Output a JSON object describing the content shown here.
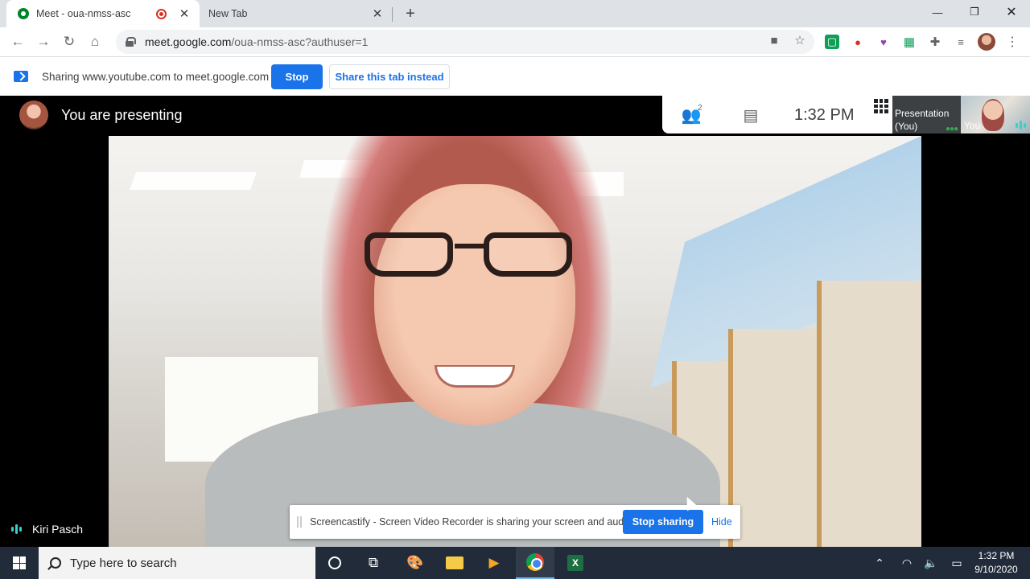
{
  "browser": {
    "tabs": [
      {
        "title": "Meet - oua-nmss-asc",
        "active": true,
        "recording": true
      },
      {
        "title": "New Tab",
        "active": false
      }
    ],
    "url_host": "meet.google.com",
    "url_path": "/oua-nmss-asc?authuser=1"
  },
  "infobar": {
    "message": "Sharing www.youtube.com to meet.google.com",
    "stop_label": "Stop",
    "share_tab_label": "Share this tab instead"
  },
  "meet": {
    "presenting_text": "You are presenting",
    "participants_badge": "2",
    "time": "1:32  PM",
    "presentation_tile_label": "Presentation (You)",
    "self_tile_label": "You",
    "speaker_name": "Kiri Pasch"
  },
  "screencastify": {
    "message": "Screencastify - Screen Video Recorder is sharing your screen and audio.",
    "stop_sharing_label": "Stop sharing",
    "hide_label": "Hide"
  },
  "taskbar": {
    "search_placeholder": "Type here to search",
    "clock_time": "1:32 PM",
    "clock_date": "9/10/2020"
  },
  "colors": {
    "accent": "#1a73e8",
    "taskbar": "#212b3a",
    "tabstrip": "#dee1e6",
    "speaking_indicator": "#34d4c4"
  }
}
